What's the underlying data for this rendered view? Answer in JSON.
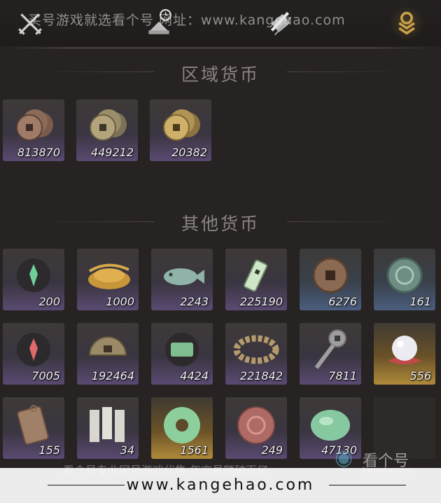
{
  "watermark": {
    "top": "买号游戏就选看个号  网址：www.kangehao.com",
    "bottom_faint": "看个号专业网号游戏代售  年交易额破百亿",
    "bottom_url": "www.kangehao.com",
    "logo": "看个号",
    "logo_sub": "kangehao.com"
  },
  "tabs": [
    {
      "icon": "crossed-swords-icon"
    },
    {
      "icon": "timed-equipment-icon"
    },
    {
      "icon": "scroll-icon"
    },
    {
      "icon": "currency-icon",
      "active": true
    }
  ],
  "sections": {
    "region": {
      "title": "区域货币",
      "items": [
        {
          "icon": "copper-coin-stack-icon",
          "qty": "813870"
        },
        {
          "icon": "brass-coin-stack-icon",
          "qty": "449212"
        },
        {
          "icon": "gold-coin-stack-icon",
          "qty": "20382"
        }
      ]
    },
    "other": {
      "title": "其他货币",
      "items": [
        {
          "icon": "jade-sigil-icon",
          "qty": "200"
        },
        {
          "icon": "grain-pile-icon",
          "qty": "1000"
        },
        {
          "icon": "jade-fish-icon",
          "qty": "2243"
        },
        {
          "icon": "jade-tablet-icon",
          "qty": "225190"
        },
        {
          "icon": "ancient-coin-icon",
          "qty": "6276"
        },
        {
          "icon": "jade-medallion-icon",
          "qty": "161"
        },
        {
          "icon": "red-sigil-icon",
          "qty": "7005"
        },
        {
          "icon": "half-coin-icon",
          "qty": "192464"
        },
        {
          "icon": "jade-token-icon",
          "qty": "4424"
        },
        {
          "icon": "coin-string-icon",
          "qty": "221842"
        },
        {
          "icon": "key-coin-icon",
          "qty": "7811"
        },
        {
          "icon": "pearl-icon",
          "qty": "556"
        },
        {
          "icon": "bronze-plaque-icon",
          "qty": "155"
        },
        {
          "icon": "paper-notes-icon",
          "qty": "34"
        },
        {
          "icon": "jade-disc-icon",
          "qty": "1561"
        },
        {
          "icon": "red-jade-icon",
          "qty": "249"
        },
        {
          "icon": "jade-stone-icon",
          "qty": "47130"
        }
      ]
    }
  },
  "colors": {
    "accent": "#c9a04a",
    "background": "#262322",
    "rarity_purple": "#5a4a72",
    "rarity_blue": "#4b5e7e",
    "rarity_gold": "#b08a3a"
  }
}
